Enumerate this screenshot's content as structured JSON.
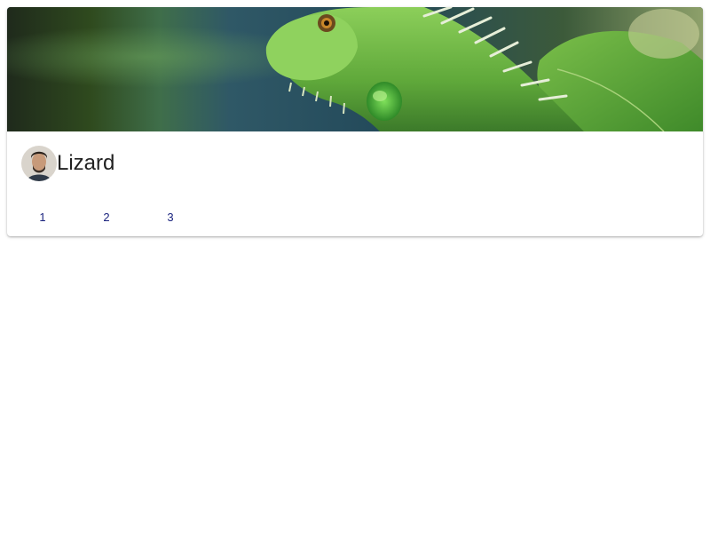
{
  "card": {
    "title": "Lizard",
    "media": {
      "subject": "iguana-photo"
    },
    "avatar": {
      "subject": "person-portrait"
    },
    "actions": [
      {
        "label": "1"
      },
      {
        "label": "2"
      },
      {
        "label": "3"
      }
    ]
  },
  "colors": {
    "title_text": "#212121",
    "action_text": "#1a237e",
    "card_bg": "#ffffff"
  }
}
